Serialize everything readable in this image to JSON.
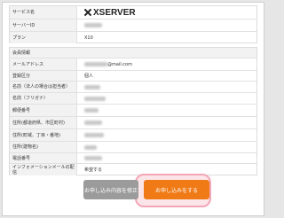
{
  "service_table": {
    "rows": [
      {
        "label": "サービス名",
        "value": "XSERVER",
        "logo": "xserver-logo"
      },
      {
        "label": "サーバーID",
        "value": ""
      },
      {
        "label": "プラン",
        "value": "X10"
      }
    ]
  },
  "member_section": {
    "heading": "会員情報",
    "rows": [
      {
        "label": "メールアドレス",
        "value": "@mail.com"
      },
      {
        "label": "登録区分",
        "value": "個人"
      },
      {
        "label": "名前（法人の場合は担当者）",
        "value": ""
      },
      {
        "label": "名前（フリガナ）",
        "value": ""
      },
      {
        "label": "郵便番号",
        "value": ""
      },
      {
        "label": "住所(都道府県、市区町村)",
        "value": ""
      },
      {
        "label": "住所(町域、丁目・番地)",
        "value": ""
      },
      {
        "label": "住所(建物名)",
        "value": ""
      },
      {
        "label": "電話番号",
        "value": ""
      },
      {
        "label": "インフォメーションメールの配信",
        "value": "希望する"
      }
    ]
  },
  "buttons": {
    "edit_label": "お申し込み内容を修正",
    "submit_label": "お申し込みをする"
  },
  "colors": {
    "submit": "#f07a16",
    "edit": "#9b9b9b",
    "highlight": "#f3a6b6"
  }
}
